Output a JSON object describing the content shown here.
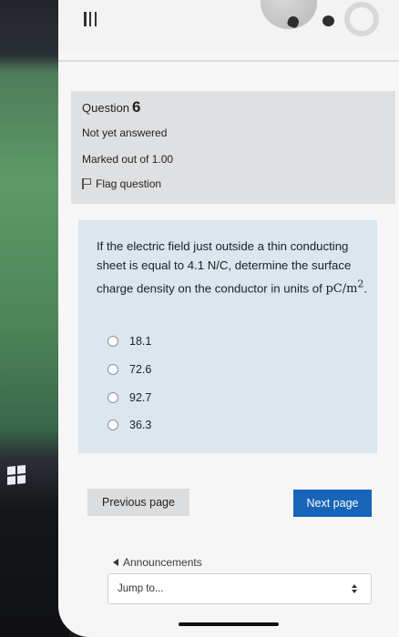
{
  "question": {
    "label": "Question",
    "number": "6",
    "status": "Not yet answered",
    "marked": "Marked out of 1.00",
    "flag_label": "Flag question"
  },
  "content": {
    "text_before_unit": "If the electric field just outside a thin conducting sheet is equal to 4.1 N/C, determine the surface charge density on the conductor in units of ",
    "unit": "pC/m",
    "unit_exponent": "2",
    "text_after_unit": ".",
    "options": [
      "18.1",
      "72.6",
      "92.7",
      "36.3"
    ]
  },
  "nav": {
    "previous": "Previous page",
    "next": "Next page",
    "announcements": "Announcements",
    "jump_placeholder": "Jump to..."
  },
  "colors": {
    "primary_button": "#1764b8",
    "question_bg": "#dbe6ef",
    "info_bg": "#dfe0e2"
  },
  "icons": [
    "hamburger-menu-icon",
    "notification-bell-icon",
    "chat-icon",
    "user-avatar-icon",
    "flag-icon",
    "windows-logo-icon"
  ]
}
